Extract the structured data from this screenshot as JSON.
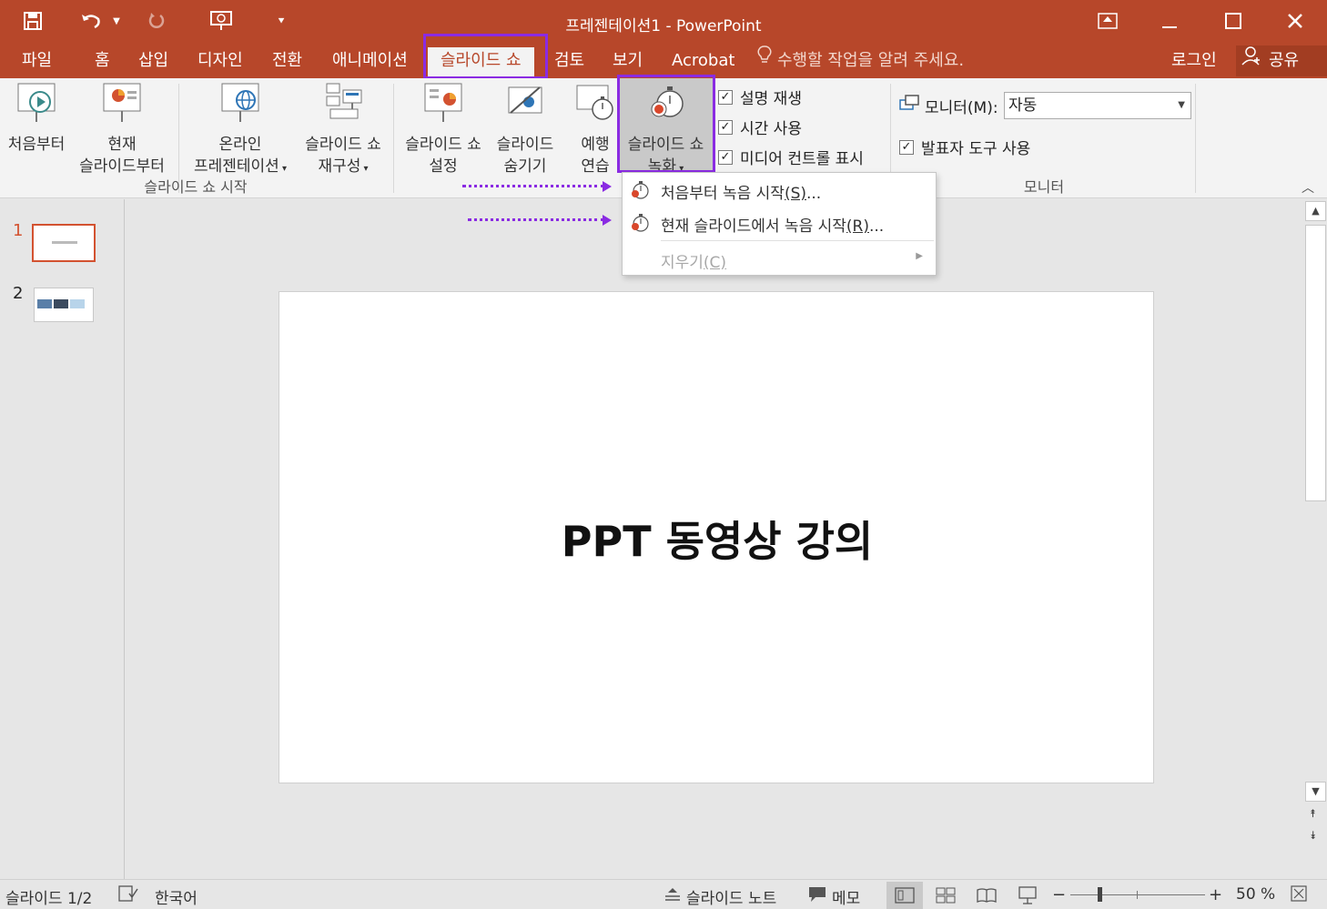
{
  "window": {
    "title": "프레젠테이션1 - PowerPoint",
    "controls": [
      "ribbon-display-icon",
      "minimize-icon",
      "maximize-icon",
      "close-icon"
    ]
  },
  "quick_access": [
    "save-icon",
    "undo-icon",
    "redo-icon",
    "present-icon",
    "customize-icon"
  ],
  "tabs": [
    {
      "label": "파일"
    },
    {
      "label": "홈"
    },
    {
      "label": "삽입"
    },
    {
      "label": "디자인"
    },
    {
      "label": "전환"
    },
    {
      "label": "애니메이션"
    },
    {
      "label": "슬라이드 쇼",
      "active": true
    },
    {
      "label": "검토"
    },
    {
      "label": "보기"
    },
    {
      "label": "Acrobat"
    }
  ],
  "tellme": "수행할 작업을 알려 주세요.",
  "account": {
    "signin": "로그인",
    "share": "공유"
  },
  "ribbon": {
    "start_group": {
      "label": "슬라이드 쇼 시작",
      "buttons": [
        {
          "line1": "처음부터",
          "line2": ""
        },
        {
          "line1": "현재",
          "line2": "슬라이드부터"
        },
        {
          "line1": "온라인",
          "line2": "프레젠테이션"
        },
        {
          "line1": "슬라이드 쇼",
          "line2": "재구성"
        }
      ]
    },
    "setup_group": {
      "buttons": [
        {
          "line1": "슬라이드 쇼",
          "line2": "설정"
        },
        {
          "line1": "슬라이드",
          "line2": "숨기기"
        },
        {
          "line1": "예행",
          "line2": "연습"
        },
        {
          "line1": "슬라이드 쇼",
          "line2": "녹화"
        }
      ],
      "checks": [
        {
          "label": "설명 재생",
          "checked": true
        },
        {
          "label": "시간 사용",
          "checked": true
        },
        {
          "label": "미디어 컨트롤 표시",
          "checked": true
        }
      ]
    },
    "monitor_group": {
      "label": "모니터",
      "monitor_label": "모니터(M):",
      "monitor_value": "자동",
      "presenter_view": {
        "label": "발표자 도구 사용",
        "checked": true
      }
    }
  },
  "record_menu": {
    "items": [
      {
        "label": "처음부터 녹음 시작",
        "accel": "(S)",
        "suffix": "...",
        "enabled": true
      },
      {
        "label": "현재 슬라이드에서 녹음 시작",
        "accel": "(R)",
        "suffix": "...",
        "enabled": true
      },
      {
        "label": "지우기",
        "accel": "(C)",
        "suffix": "",
        "enabled": false
      }
    ]
  },
  "slides": [
    {
      "number": "1",
      "selected": true
    },
    {
      "number": "2",
      "selected": false
    }
  ],
  "current_slide": {
    "title": "PPT 동영상 강의"
  },
  "status": {
    "slide_info": "슬라이드 1/2",
    "language": "한국어",
    "notes": "슬라이드 노트",
    "comments": "메모",
    "zoom": "50 %"
  },
  "colors": {
    "accent": "#b7472a",
    "highlight": "#8a2be2",
    "record_red": "#d9472b"
  }
}
